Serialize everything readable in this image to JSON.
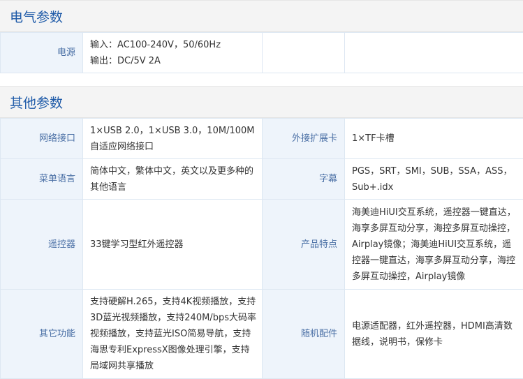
{
  "electrical": {
    "title": "电气参数",
    "power_label": "电源",
    "power_line1": "输入：AC100-240V，50/60Hz",
    "power_line2": "输出：DC/5V 2A"
  },
  "other": {
    "title": "其他参数",
    "rows": [
      {
        "left_label": "网络接口",
        "left_value": "1×USB 2.0，1×USB 3.0，10M/100M自适应网络接口",
        "right_label": "外接扩展卡",
        "right_value": "1×TF卡槽"
      },
      {
        "left_label": "菜单语言",
        "left_value": "简体中文，繁体中文，英文以及更多种的其他语言",
        "right_label": "字幕",
        "right_value": "PGS，SRT，SMI，SUB，SSA，ASS，Sub+.idx"
      },
      {
        "left_label": "遥控器",
        "left_value": "33键学习型红外遥控器",
        "right_label": "产品特点",
        "right_value": "海美迪HiUI交互系统，遥控器一键直达，海享多屏互动分享，海控多屏互动操控，Airplay镜像；海美迪HiUI交互系统，遥控器一键直达，海享多屏互动分享，海控多屏互动操控，Airplay镜像"
      },
      {
        "left_label": "其它功能",
        "left_value": "支持硬解H.265，支持4K视频播放，支持3D蓝光视频播放，支持240M/bps大码率视频播放，支持蓝光ISO简易导航，支持海思专利ExpressX图像处理引擎，支持局域网共享播放",
        "right_label": "随机配件",
        "right_value": "电源适配器，红外遥控器，HDMI高清数据线，说明书，保修卡"
      }
    ]
  }
}
